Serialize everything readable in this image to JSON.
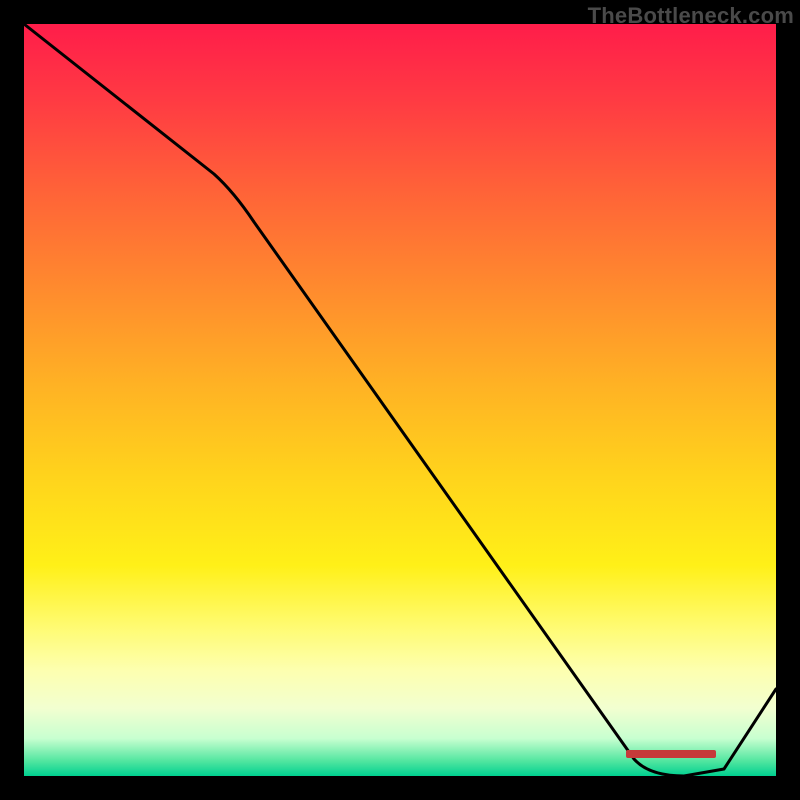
{
  "attribution": "TheBottleneck.com",
  "chart_data": {
    "type": "line",
    "title": "",
    "xlabel": "",
    "ylabel": "",
    "xlim": [
      0,
      100
    ],
    "ylim": [
      0,
      100
    ],
    "x": [
      0,
      25,
      82,
      90,
      100
    ],
    "values": [
      100,
      80,
      0,
      0,
      12
    ],
    "series_name": "bottleneck-curve",
    "gradient_meaning": "red=high bottleneck, green=low bottleneck",
    "optimal_range_x": [
      80,
      92
    ]
  },
  "marker": {
    "label": "",
    "left_pct": 80,
    "width_pct": 12,
    "bottom_pct": 2.5
  }
}
